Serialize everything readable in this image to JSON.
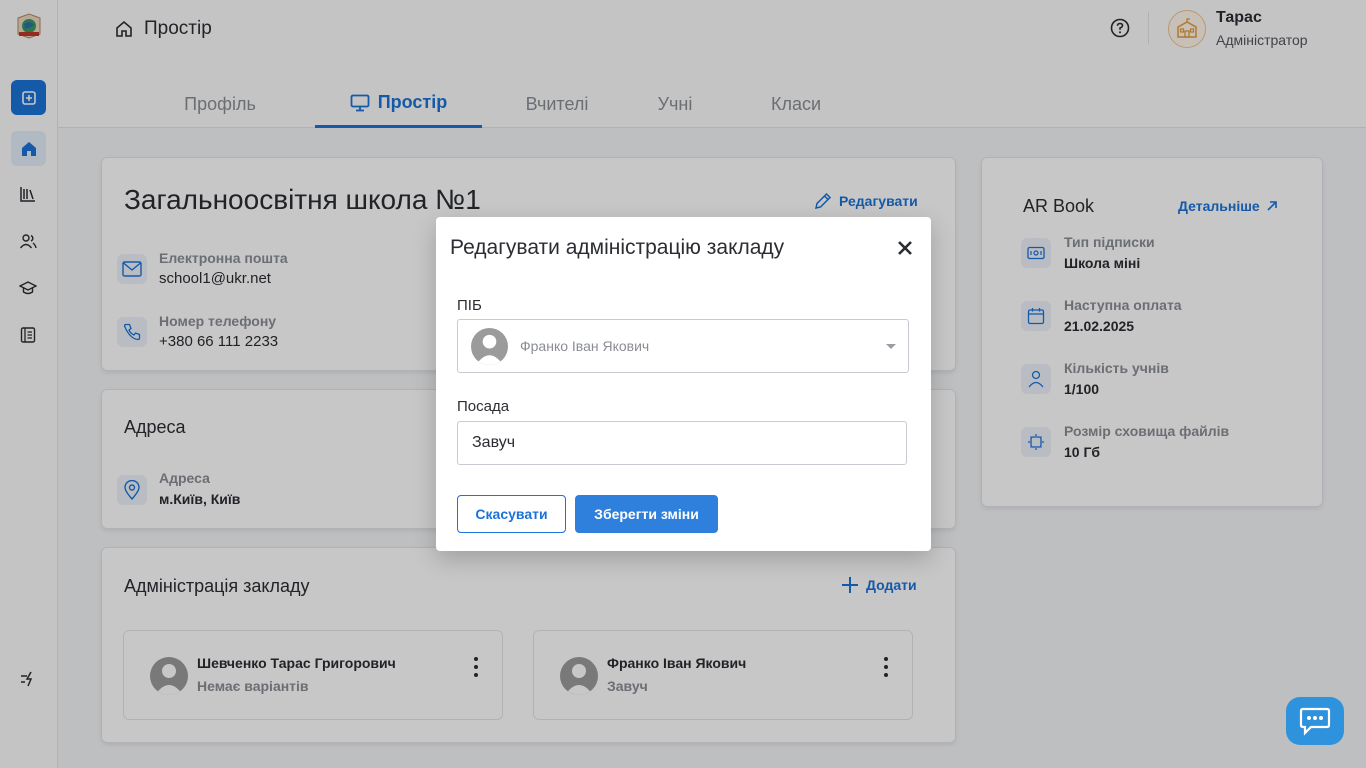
{
  "header": {
    "breadcrumb": "Простір",
    "user_name": "Тарас",
    "user_role": "Адміністратор"
  },
  "tabs": [
    {
      "label": "Профіль"
    },
    {
      "label": "Простір"
    },
    {
      "label": "Вчителі"
    },
    {
      "label": "Учні"
    },
    {
      "label": "Класи"
    }
  ],
  "school": {
    "title": "Загальноосвітня школа №1",
    "edit_label": "Редагувати",
    "email_label": "Електронна пошта",
    "email": "school1@ukr.net",
    "phone_label": "Номер телефону",
    "phone": "+380 66 111 2233"
  },
  "address": {
    "title": "Адреса",
    "label": "Адреса",
    "value": "м.Київ, Київ"
  },
  "administration": {
    "title": "Адміністрація закладу",
    "add_label": "Додати",
    "items": [
      {
        "name": "Шевченко Тарас Григорович",
        "role": "Немає варіантів"
      },
      {
        "name": "Франко Іван Якович",
        "role": "Завуч"
      }
    ]
  },
  "subscription": {
    "title": "AR Book",
    "details_label": "Детальніше",
    "rows": [
      {
        "label": "Тип підписки",
        "value": "Школа міні"
      },
      {
        "label": "Наступна оплата",
        "value": "21.02.2025"
      },
      {
        "label": "Кількість учнів",
        "value": "1/100"
      },
      {
        "label": "Розмір сховища файлів",
        "value": "10 Гб"
      }
    ]
  },
  "modal": {
    "title": "Редагувати адміністрацію закладу",
    "name_label": "ПІБ",
    "name_value": "Франко Іван Якович",
    "position_label": "Посада",
    "position_value": "Завуч",
    "cancel_label": "Скасувати",
    "save_label": "Зберегти зміни"
  },
  "colors": {
    "accent": "#1b72d9",
    "button": "#2f80dd",
    "chat": "#2f92dd"
  }
}
